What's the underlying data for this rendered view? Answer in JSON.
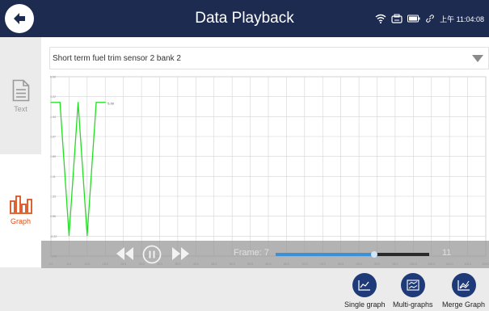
{
  "header": {
    "title": "Data Playback",
    "time": "上午 11:04:08",
    "back_icon": "back-arrow-icon",
    "status_icons": [
      "wifi-icon",
      "vci-connector-icon",
      "battery-icon",
      "link-icon"
    ]
  },
  "sidebar": {
    "items": [
      {
        "label": "Text",
        "icon": "text-document-icon"
      },
      {
        "label": "Graph",
        "icon": "bar-graph-icon"
      }
    ]
  },
  "selector": {
    "value": "Short term fuel trim sensor 2 bank 2"
  },
  "playback": {
    "frame_label": "Frame: 7",
    "frame_total": "11",
    "progress": 0.64
  },
  "toolbar": {
    "single_label": "Single graph",
    "multi_label": "Multi-graphs",
    "merge_label": "Merge Graph"
  },
  "colors": {
    "header_bg": "#1e2b50",
    "accent_orange": "#d8521e",
    "line_green": "#22dd22",
    "tool_button": "#1e3a78"
  },
  "chart_data": {
    "type": "line",
    "series": [
      {
        "values": [
          5.0,
          5.0,
          -0.2,
          5.0,
          -0.2,
          5.0,
          5.0
        ]
      }
    ],
    "x": [
      0.0,
      2.5,
      5.0,
      7.5,
      10.0,
      12.5,
      15.0
    ],
    "value_label": "5.00",
    "y_ticks": [
      "6.00",
      "5.22",
      "4.44",
      "3.67",
      "2.89",
      "2.11",
      "1.33",
      "0.56",
      "-0.22",
      "-1.00"
    ],
    "x_ticks": [
      "0.0",
      "6.0",
      "10.0",
      "15.0",
      "20.0",
      "25.0",
      "30.0",
      "35.0",
      "40.0",
      "45.0",
      "50.0",
      "55.0",
      "60.0",
      "65.0",
      "70.0",
      "75.0",
      "80.0",
      "85.0",
      "90.0",
      "95.0",
      "100.0",
      "105.0",
      "110.0",
      "115.0",
      "120.0"
    ],
    "ylim": [
      -1.0,
      6.0
    ],
    "xlim": [
      0,
      120
    ],
    "grid": true
  }
}
